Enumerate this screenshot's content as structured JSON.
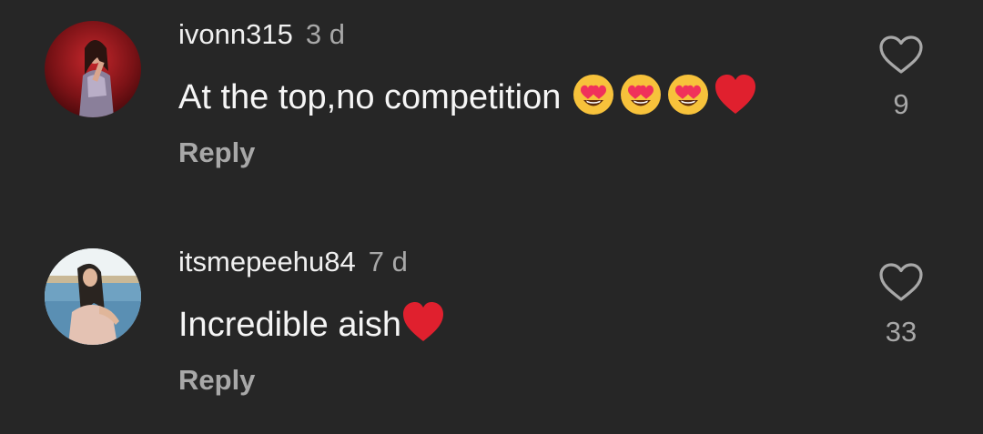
{
  "comments": [
    {
      "username": "ivonn315",
      "time": "3 d",
      "text": "At the top,no competition",
      "emojis": [
        "heart-eyes-emoji",
        "heart-eyes-emoji",
        "heart-eyes-emoji",
        "red-heart-emoji"
      ],
      "reply_label": "Reply",
      "likes": "9"
    },
    {
      "username": "itsmepeehu84",
      "time": "7 d",
      "text": "Incredible aish",
      "emojis": [
        "red-heart-emoji"
      ],
      "reply_label": "Reply",
      "likes": "33"
    }
  ],
  "colors": {
    "background": "#262626",
    "primary_text": "#f5f5f5",
    "secondary_text": "#a8a8a8",
    "heart_red": "#e0202e"
  }
}
